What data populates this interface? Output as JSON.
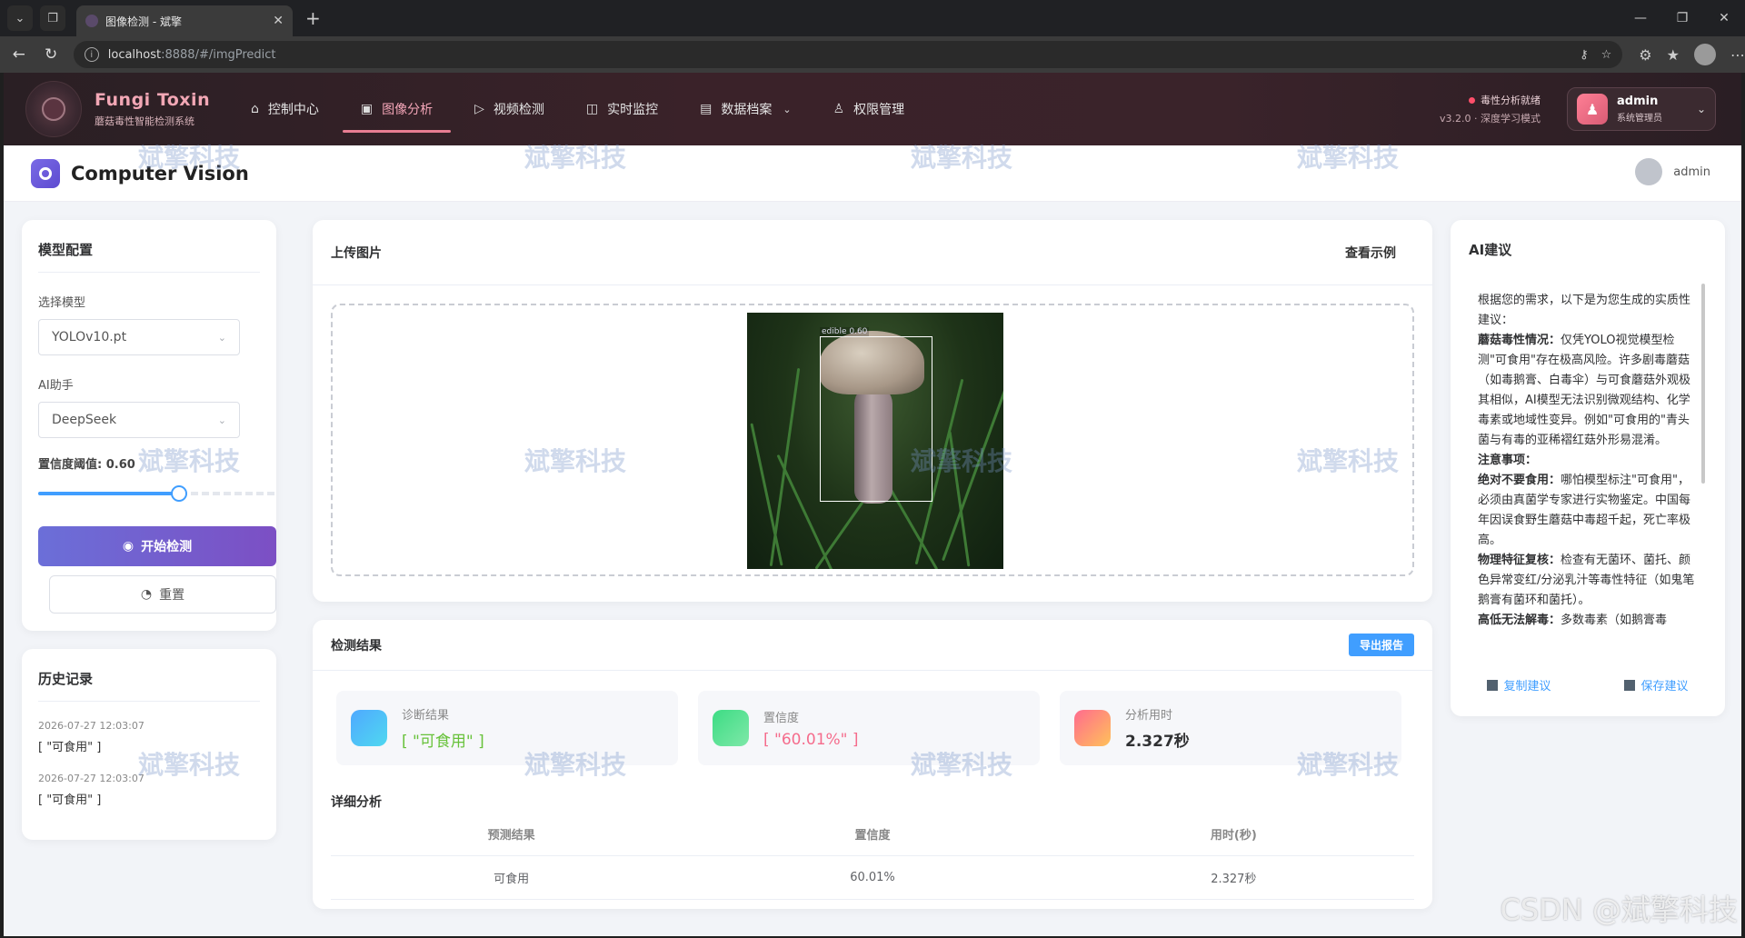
{
  "browser": {
    "tab_title": "图像检测 - 斌擎",
    "url_host": "localhost",
    "url_rest": ":8888/#/imgPredict"
  },
  "header": {
    "brand_title": "Fungi Toxin",
    "brand_subtitle": "蘑菇毒性智能检测系统",
    "nav": [
      {
        "label": "控制中心",
        "icon": "home-icon"
      },
      {
        "label": "图像分析",
        "icon": "image-icon"
      },
      {
        "label": "视频检测",
        "icon": "play-icon"
      },
      {
        "label": "实时监控",
        "icon": "camera-icon"
      },
      {
        "label": "数据档案",
        "icon": "document-icon"
      },
      {
        "label": "权限管理",
        "icon": "user-icon"
      }
    ],
    "status_text": "毒性分析就绪",
    "status_sub": "v3.2.0 · 深度学习模式",
    "user_name": "admin",
    "user_role": "系统管理员"
  },
  "topbar": {
    "title": "Computer Vision",
    "user": "admin"
  },
  "model_config": {
    "title": "模型配置",
    "model_label": "选择模型",
    "model_value": "YOLOv10.pt",
    "assistant_label": "AI助手",
    "assistant_value": "DeepSeek",
    "threshold_label": "置信度阈值: 0.60",
    "threshold_value": 0.6,
    "start_button": "开始检测",
    "reset_button": "重置"
  },
  "history": {
    "title": "历史记录",
    "items": [
      {
        "time": "2026-07-27 12:03:07",
        "value": "[ \"可食用\" ]"
      },
      {
        "time": "2026-07-27 12:03:07",
        "value": "[ \"可食用\" ]"
      }
    ]
  },
  "upload": {
    "title": "上传图片",
    "example_link": "查看示例",
    "detection_label": "edible 0.60"
  },
  "results": {
    "title": "检测结果",
    "export_button": "导出报告",
    "stats": [
      {
        "label": "诊断结果",
        "value": "[ \"可食用\" ]",
        "color": "#67c23a"
      },
      {
        "label": "置信度",
        "value": "[ \"60.01%\" ]",
        "color": "#f56c8c"
      },
      {
        "label": "分析用时",
        "value": "2.327秒",
        "color": "#303133"
      }
    ],
    "detail_title": "详细分析",
    "table_headers": [
      "预测结果",
      "置信度",
      "用时(秒)"
    ],
    "table_rows": [
      [
        "可食用",
        "60.01%",
        "2.327秒"
      ]
    ]
  },
  "ai": {
    "title": "AI建议",
    "intro": "根据您的需求，以下是为您生成的实质性建议：",
    "p1_bold": "蘑菇毒性情况：",
    "p1": "仅凭YOLO视觉模型检测\"可食用\"存在极高风险。许多剧毒蘑菇（如毒鹅膏、白毒伞）与可食蘑菇外观极其相似，AI模型无法识别微观结构、化学毒素或地域性变异。例如\"可食用的\"青头菌与有毒的亚稀褶红菇外形易混淆。",
    "notice": "注意事项：",
    "p2_bold": "绝对不要食用：",
    "p2": "哪怕模型标注\"可食用\"，必须由真菌学专家进行实物鉴定。中国每年因误食野生蘑菇中毒超千起，死亡率极高。",
    "p3_bold": "物理特征复核：",
    "p3": "检查有无菌环、菌托、颜色异常变红/分泌乳汁等毒性特征（如鬼笔鹅膏有菌环和菌托）。",
    "p4_bold": "高低无法解毒：",
    "p4": "多数毒素（如鹅膏毒",
    "copy_button": "复制建议",
    "save_button": "保存建议"
  },
  "watermark": "斌擎科技",
  "csdn": "CSDN @斌擎科技"
}
